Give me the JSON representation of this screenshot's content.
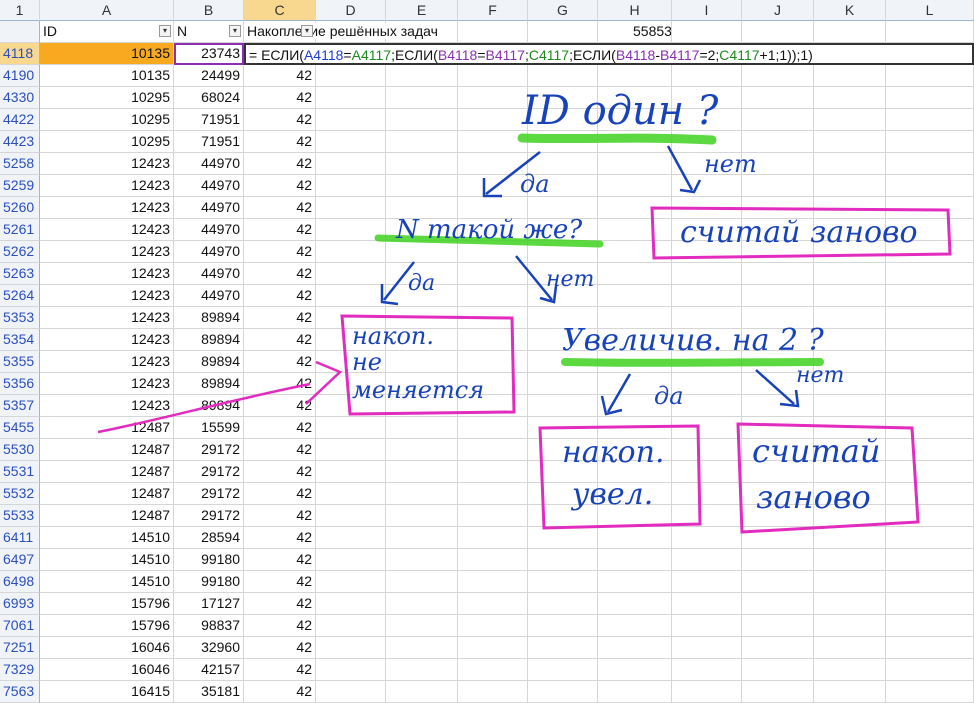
{
  "columns": {
    "corner": "1",
    "letters": [
      "A",
      "B",
      "C",
      "D",
      "E",
      "F",
      "G",
      "H",
      "I",
      "J",
      "K",
      "L"
    ]
  },
  "header_row": {
    "id_label": "ID",
    "n_label": "N",
    "c_label": "Накопление решённых задач",
    "h_value": "55853"
  },
  "active_row": {
    "row": "4118",
    "a": "10135",
    "b": "23743",
    "formula_parts": [
      {
        "t": "= ЕСЛИ(",
        "c": "blk"
      },
      {
        "t": "A4118",
        "c": "blu"
      },
      {
        "t": "=",
        "c": "blk"
      },
      {
        "t": "A4117",
        "c": "grn"
      },
      {
        "t": ";ЕСЛИ(",
        "c": "blk"
      },
      {
        "t": "B4118",
        "c": "pur"
      },
      {
        "t": "=",
        "c": "blk"
      },
      {
        "t": "B4117",
        "c": "pur"
      },
      {
        "t": ";",
        "c": "blk"
      },
      {
        "t": "C4117",
        "c": "grn"
      },
      {
        "t": ";ЕСЛИ(",
        "c": "blk"
      },
      {
        "t": "B4118",
        "c": "pur"
      },
      {
        "t": "-",
        "c": "blk"
      },
      {
        "t": "B4117",
        "c": "pur"
      },
      {
        "t": "=2;",
        "c": "blk"
      },
      {
        "t": "C4117",
        "c": "grn"
      },
      {
        "t": "+1;1));1)",
        "c": "blk"
      }
    ]
  },
  "rows": [
    {
      "r": "4190",
      "a": "10135",
      "b": "24499",
      "c": "42"
    },
    {
      "r": "4330",
      "a": "10295",
      "b": "68024",
      "c": "42"
    },
    {
      "r": "4422",
      "a": "10295",
      "b": "71951",
      "c": "42"
    },
    {
      "r": "4423",
      "a": "10295",
      "b": "71951",
      "c": "42"
    },
    {
      "r": "5258",
      "a": "12423",
      "b": "44970",
      "c": "42"
    },
    {
      "r": "5259",
      "a": "12423",
      "b": "44970",
      "c": "42"
    },
    {
      "r": "5260",
      "a": "12423",
      "b": "44970",
      "c": "42"
    },
    {
      "r": "5261",
      "a": "12423",
      "b": "44970",
      "c": "42"
    },
    {
      "r": "5262",
      "a": "12423",
      "b": "44970",
      "c": "42"
    },
    {
      "r": "5263",
      "a": "12423",
      "b": "44970",
      "c": "42"
    },
    {
      "r": "5264",
      "a": "12423",
      "b": "44970",
      "c": "42"
    },
    {
      "r": "5353",
      "a": "12423",
      "b": "89894",
      "c": "42"
    },
    {
      "r": "5354",
      "a": "12423",
      "b": "89894",
      "c": "42"
    },
    {
      "r": "5355",
      "a": "12423",
      "b": "89894",
      "c": "42"
    },
    {
      "r": "5356",
      "a": "12423",
      "b": "89894",
      "c": "42"
    },
    {
      "r": "5357",
      "a": "12423",
      "b": "89894",
      "c": "42"
    },
    {
      "r": "5455",
      "a": "12487",
      "b": "15599",
      "c": "42"
    },
    {
      "r": "5530",
      "a": "12487",
      "b": "29172",
      "c": "42"
    },
    {
      "r": "5531",
      "a": "12487",
      "b": "29172",
      "c": "42"
    },
    {
      "r": "5532",
      "a": "12487",
      "b": "29172",
      "c": "42"
    },
    {
      "r": "5533",
      "a": "12487",
      "b": "29172",
      "c": "42"
    },
    {
      "r": "6411",
      "a": "14510",
      "b": "28594",
      "c": "42"
    },
    {
      "r": "6497",
      "a": "14510",
      "b": "99180",
      "c": "42"
    },
    {
      "r": "6498",
      "a": "14510",
      "b": "99180",
      "c": "42"
    },
    {
      "r": "6993",
      "a": "15796",
      "b": "17127",
      "c": "42"
    },
    {
      "r": "7061",
      "a": "15796",
      "b": "98837",
      "c": "42"
    },
    {
      "r": "7251",
      "a": "16046",
      "b": "32960",
      "c": "42"
    },
    {
      "r": "7329",
      "a": "16046",
      "b": "42157",
      "c": "42"
    },
    {
      "r": "7563",
      "a": "16415",
      "b": "35181",
      "c": "42"
    }
  ],
  "annotations": {
    "q1": "ID один ?",
    "yes1": "да",
    "no1": "нет",
    "box_restart1": "считай заново",
    "q2": "N такой же?",
    "yes2": "да",
    "no2": "нет",
    "box_keep": [
      "накоп.",
      "не",
      "меняется"
    ],
    "q3": "Увеличив. на 2 ?",
    "yes3": "да",
    "no3": "нет",
    "box_inc": [
      "накоп.",
      "увел."
    ],
    "box_restart2": [
      "считай",
      "заново"
    ],
    "colors": {
      "ink": "#1842b8",
      "highlight": "#3fd21f",
      "box": "#e22bbf",
      "selected": "#f8a91f"
    }
  }
}
